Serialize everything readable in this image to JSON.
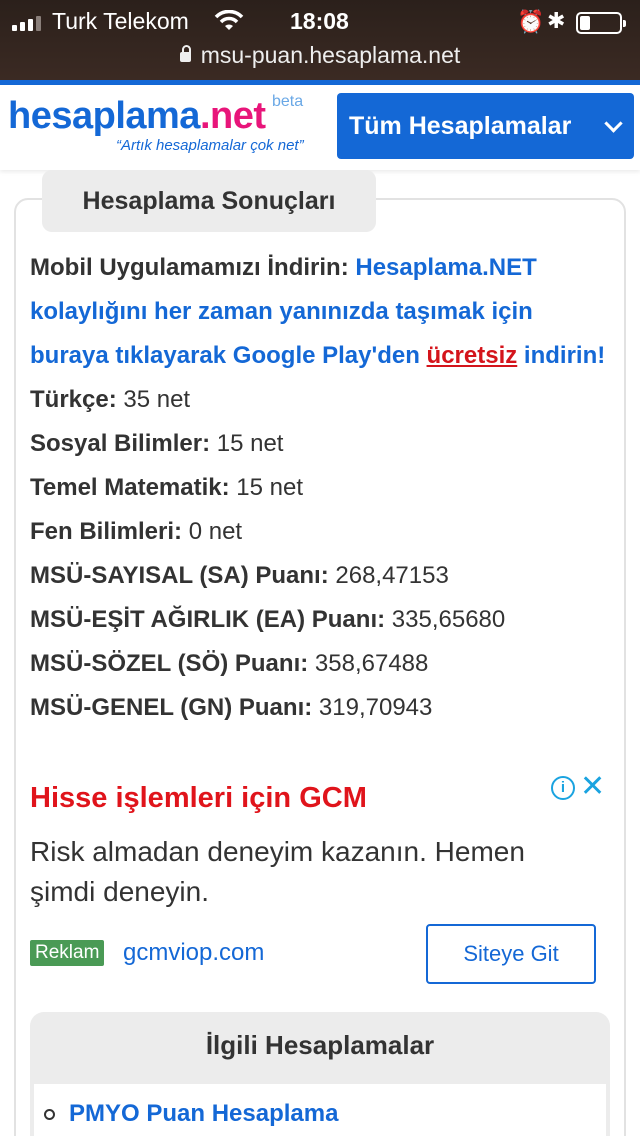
{
  "status_bar": {
    "carrier": "Turk Telekom",
    "time": "18:08",
    "url": "msu-puan.hesaplama.net",
    "icons": [
      "signal-icon",
      "wifi-icon",
      "alarm-icon",
      "bluetooth-icon",
      "battery-icon"
    ],
    "battery_level": 0.25
  },
  "header": {
    "logo_part1": "hesaplama",
    "logo_part2": ".net",
    "beta": "beta",
    "slogan": "“Artık hesaplamalar çok net”",
    "all_button": "Tüm Hesaplamalar",
    "colors": {
      "brand_blue": "#1468d6",
      "brand_pink": "#e8157a"
    }
  },
  "results": {
    "tab_title": "Hesaplama Sonuçları",
    "promo": {
      "prefix": "Mobil Uygulamamızı İndirin: ",
      "link1": "Hesaplama.NET kolaylığını her zaman yanınızda taşımak için buraya tıklayarak Google Play'den ",
      "link2": "ücretsiz",
      "link3": " indirin!"
    },
    "rows": [
      {
        "label": "Türkçe:",
        "value": "35 net"
      },
      {
        "label": "Sosyal Bilimler:",
        "value": "15 net"
      },
      {
        "label": "Temel Matematik:",
        "value": "15 net"
      },
      {
        "label": "Fen Bilimleri:",
        "value": "0 net"
      },
      {
        "label": "MSÜ-SAYISAL (SA) Puanı:",
        "value": "268,47153"
      },
      {
        "label": "MSÜ-EŞİT AĞIRLIK (EA) Puanı:",
        "value": "335,65680"
      },
      {
        "label": "MSÜ-SÖZEL (SÖ) Puanı:",
        "value": "358,67488"
      },
      {
        "label": "MSÜ-GENEL (GN) Puanı:",
        "value": "319,70943"
      }
    ]
  },
  "ad": {
    "title": "Hisse işlemleri için GCM",
    "description": "Risk almadan deneyim kazanın. Hemen şimdi deneyin.",
    "badge": "Reklam",
    "domain": "gcmviop.com",
    "button": "Siteye Git",
    "colors": {
      "title": "#e0141b",
      "badge": "#4a9a55"
    }
  },
  "related": {
    "title": "İlgili Hesaplamalar",
    "items": [
      "PMYO Puan Hesaplama"
    ]
  }
}
